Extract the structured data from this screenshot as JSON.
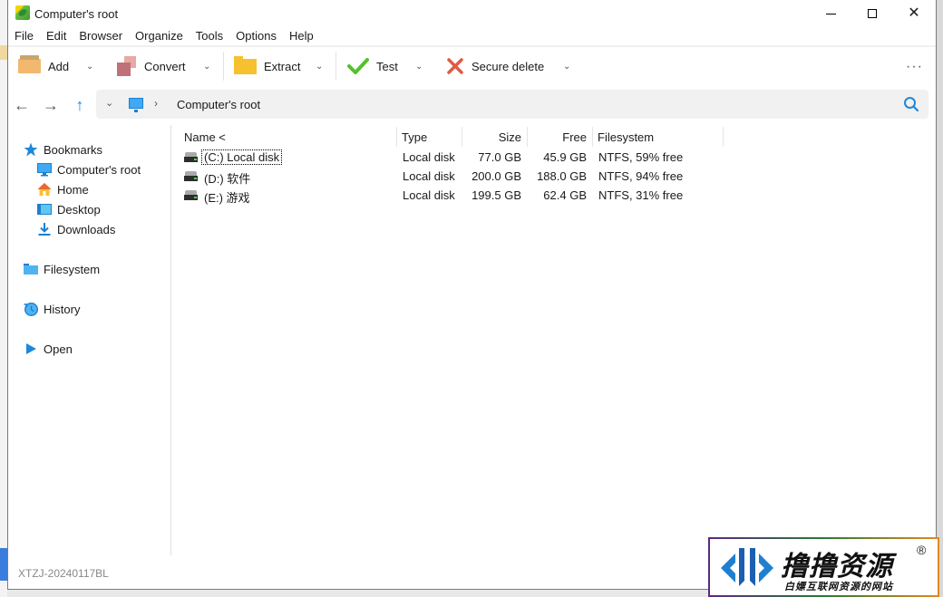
{
  "window": {
    "title": "Computer's root",
    "controls": {
      "minimize": "—",
      "maximize": "□",
      "close": "✕"
    }
  },
  "menu": [
    "File",
    "Edit",
    "Browser",
    "Organize",
    "Tools",
    "Options",
    "Help"
  ],
  "toolbar": {
    "add_label": "Add",
    "convert_label": "Convert",
    "extract_label": "Extract",
    "test_label": "Test",
    "secure_delete_label": "Secure delete",
    "chevron": "⌄",
    "more": "···"
  },
  "nav": {
    "back": "←",
    "forward": "→",
    "up": "↑",
    "history_chevron": "⌄",
    "separator": "›",
    "path": "Computer's root"
  },
  "sidebar": {
    "bookmarks": {
      "label": "Bookmarks",
      "items": [
        {
          "label": "Computer's root",
          "icon": "computer-icon"
        },
        {
          "label": "Home",
          "icon": "home-icon"
        },
        {
          "label": "Desktop",
          "icon": "desktop-icon"
        },
        {
          "label": "Downloads",
          "icon": "download-icon"
        }
      ]
    },
    "filesystem": "Filesystem",
    "history": "History",
    "open": "Open"
  },
  "filelist": {
    "columns": {
      "name": "Name <",
      "type": "Type",
      "size": "Size",
      "free": "Free",
      "filesystem": "Filesystem"
    },
    "rows": [
      {
        "name": "(C:) Local disk",
        "type": "Local disk",
        "size": "77.0 GB",
        "free": "45.9 GB",
        "filesystem": "NTFS, 59% free"
      },
      {
        "name": "(D:) 软件",
        "type": "Local disk",
        "size": "200.0 GB",
        "free": "188.0 GB",
        "filesystem": "NTFS, 94% free"
      },
      {
        "name": "(E:) 游戏",
        "type": "Local disk",
        "size": "199.5 GB",
        "free": "62.4 GB",
        "filesystem": "NTFS, 31% free"
      }
    ]
  },
  "status": "XTZJ-20240117BL",
  "watermark": {
    "title": "撸撸资源",
    "reg": "®",
    "subtitle": "白嫖互联网资源的网站"
  },
  "colors": {
    "accent": "#1e88d8",
    "test_green": "#52c22b",
    "delete_red": "#e05a44"
  }
}
